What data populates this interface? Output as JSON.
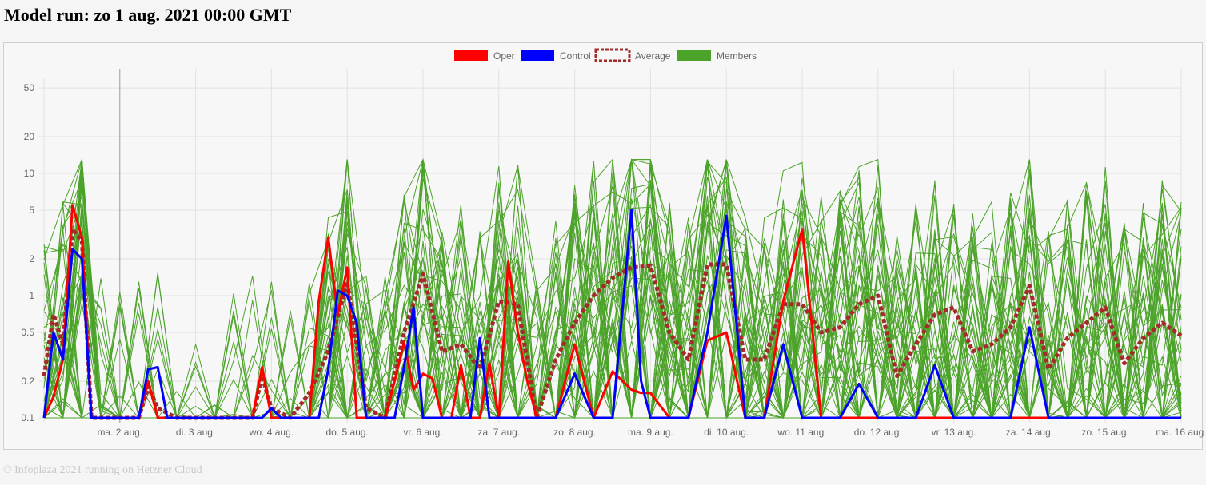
{
  "page": {
    "title": "Model run: zo 1 aug. 2021 00:00 GMT",
    "footer": "© Infoplaza 2021 running on Hetzner Cloud"
  },
  "chart_data": {
    "type": "line",
    "title": "Model run: zo 1 aug. 2021 00:00 GMT",
    "xlabel": "",
    "ylabel": "",
    "y_scale": "log",
    "ylim": [
      0.1,
      60
    ],
    "y_ticks": [
      0.1,
      0.2,
      0.5,
      1,
      2,
      5,
      10,
      20,
      50
    ],
    "grid": true,
    "legend_position": "top-center",
    "x_tick_labels": [
      "ma. 2 aug.",
      "di. 3 aug.",
      "wo. 4 aug.",
      "do. 5 aug.",
      "vr. 6 aug.",
      "za. 7 aug.",
      "zo. 8 aug.",
      "ma. 9 aug.",
      "di. 10 aug.",
      "wo. 11 aug.",
      "do. 12 aug.",
      "vr. 13 aug.",
      "za. 14 aug.",
      "zo. 15 aug.",
      "ma. 16 aug."
    ],
    "x_ticks": [
      24,
      48,
      72,
      96,
      120,
      144,
      168,
      192,
      216,
      240,
      264,
      288,
      312,
      336,
      360
    ],
    "x_range": [
      0,
      360
    ],
    "x_unit": "hours after model run",
    "legend": [
      {
        "name": "Oper",
        "color": "#ff0000",
        "style": "solid"
      },
      {
        "name": "Control",
        "color": "#0000ff",
        "style": "solid"
      },
      {
        "name": "Average",
        "color": "#a52a2a",
        "style": "dashed"
      },
      {
        "name": "Members",
        "color": "#4ca32a",
        "style": "solid"
      }
    ],
    "series": [
      {
        "name": "Oper",
        "color": "#ff0000",
        "x": [
          0,
          3,
          6,
          9,
          12,
          15,
          18,
          21,
          24,
          30,
          33,
          36,
          39,
          42,
          48,
          54,
          60,
          66,
          69,
          72,
          75,
          78,
          81,
          84,
          87,
          90,
          93,
          96,
          99,
          102,
          105,
          108,
          111,
          114,
          117,
          120,
          123,
          126,
          129,
          132,
          135,
          138,
          141,
          144,
          147,
          150,
          153,
          156,
          162,
          168,
          174,
          180,
          186,
          189,
          192,
          198,
          204,
          210,
          216,
          222,
          228,
          234,
          240,
          246,
          252,
          258,
          264,
          270,
          276,
          282,
          288,
          294,
          300,
          306,
          312,
          318,
          324,
          330,
          336,
          342,
          348,
          354,
          360
        ],
        "y": [
          0.1,
          0.15,
          0.3,
          5.5,
          3.0,
          0.1,
          0.1,
          0.1,
          0.1,
          0.1,
          0.2,
          0.1,
          0.1,
          0.1,
          0.1,
          0.1,
          0.1,
          0.1,
          0.26,
          0.1,
          0.1,
          0.1,
          0.1,
          0.1,
          0.9,
          3.0,
          0.7,
          1.7,
          0.1,
          0.1,
          0.1,
          0.1,
          0.2,
          0.42,
          0.17,
          0.23,
          0.21,
          0.1,
          0.1,
          0.27,
          0.1,
          0.1,
          0.28,
          0.1,
          1.9,
          0.5,
          0.2,
          0.1,
          0.1,
          0.4,
          0.1,
          0.24,
          0.17,
          0.16,
          0.16,
          0.1,
          0.1,
          0.43,
          0.5,
          0.1,
          0.1,
          0.9,
          3.5,
          0.1,
          0.1,
          0.1,
          0.1,
          0.1,
          0.1,
          0.1,
          0.1,
          0.1,
          0.1,
          0.1,
          0.1,
          0.1,
          0.1,
          0.1,
          0.1,
          0.1,
          0.1,
          0.1,
          0.1
        ]
      },
      {
        "name": "Control",
        "color": "#0000ff",
        "x": [
          0,
          3,
          6,
          9,
          12,
          15,
          18,
          24,
          30,
          33,
          36,
          39,
          42,
          48,
          54,
          60,
          63,
          66,
          69,
          72,
          75,
          78,
          84,
          87,
          90,
          93,
          96,
          99,
          102,
          105,
          108,
          111,
          114,
          117,
          120,
          123,
          126,
          132,
          135,
          138,
          141,
          144,
          150,
          156,
          162,
          168,
          174,
          180,
          186,
          189,
          192,
          198,
          204,
          210,
          216,
          222,
          228,
          234,
          240,
          246,
          252,
          258,
          264,
          270,
          276,
          282,
          288,
          294,
          300,
          306,
          312,
          318,
          324,
          330,
          336,
          342,
          348,
          354,
          360
        ],
        "y": [
          0.1,
          0.5,
          0.3,
          2.4,
          2.0,
          0.1,
          0.1,
          0.1,
          0.1,
          0.25,
          0.26,
          0.1,
          0.1,
          0.1,
          0.1,
          0.1,
          0.1,
          0.1,
          0.1,
          0.12,
          0.1,
          0.1,
          0.1,
          0.1,
          0.25,
          1.1,
          1.0,
          0.6,
          0.1,
          0.1,
          0.1,
          0.1,
          0.26,
          0.8,
          0.1,
          0.1,
          0.1,
          0.1,
          0.1,
          0.45,
          0.1,
          0.1,
          0.1,
          0.1,
          0.1,
          0.23,
          0.1,
          0.1,
          5.0,
          0.2,
          0.1,
          0.1,
          0.1,
          0.5,
          4.5,
          0.1,
          0.1,
          0.4,
          0.1,
          0.1,
          0.1,
          0.19,
          0.1,
          0.1,
          0.1,
          0.27,
          0.1,
          0.1,
          0.1,
          0.1,
          0.55,
          0.1,
          0.1,
          0.1,
          0.1,
          0.1,
          0.1,
          0.1,
          0.1
        ]
      },
      {
        "name": "Average",
        "color": "#a52a2a",
        "x": [
          0,
          3,
          6,
          9,
          12,
          15,
          18,
          24,
          30,
          33,
          36,
          42,
          48,
          54,
          60,
          66,
          69,
          72,
          78,
          84,
          90,
          96,
          102,
          108,
          114,
          120,
          126,
          132,
          138,
          144,
          150,
          156,
          162,
          168,
          174,
          180,
          186,
          192,
          198,
          204,
          210,
          216,
          222,
          228,
          234,
          240,
          246,
          252,
          258,
          264,
          270,
          276,
          282,
          288,
          294,
          300,
          306,
          312,
          318,
          324,
          330,
          336,
          342,
          348,
          354,
          360
        ],
        "y": [
          0.22,
          0.7,
          0.4,
          3.5,
          2.8,
          0.1,
          0.1,
          0.1,
          0.1,
          0.18,
          0.12,
          0.1,
          0.1,
          0.1,
          0.1,
          0.1,
          0.22,
          0.12,
          0.1,
          0.16,
          0.35,
          1.3,
          0.12,
          0.1,
          0.5,
          1.5,
          0.35,
          0.4,
          0.25,
          0.9,
          0.85,
          0.1,
          0.3,
          0.6,
          1.0,
          1.4,
          1.7,
          1.75,
          0.5,
          0.3,
          1.8,
          1.8,
          0.3,
          0.3,
          0.85,
          0.85,
          0.5,
          0.55,
          0.85,
          1.0,
          0.22,
          0.4,
          0.7,
          0.8,
          0.35,
          0.4,
          0.55,
          1.2,
          0.25,
          0.45,
          0.6,
          0.8,
          0.28,
          0.45,
          0.6,
          0.47
        ]
      }
    ],
    "members": {
      "name": "Members",
      "color": "#4ca32a",
      "count": 50,
      "y_range_observed": [
        0.1,
        13
      ]
    }
  }
}
